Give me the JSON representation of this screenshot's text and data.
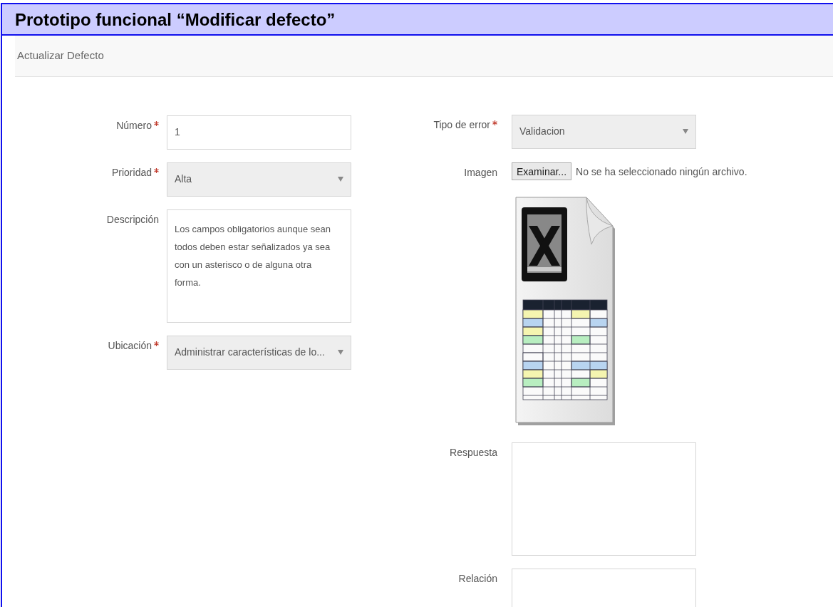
{
  "document_heading": "Prototipo funcional “Modificar defecto”",
  "panel": {
    "title": "Actualizar Defecto"
  },
  "left_fields": [
    {
      "kind": "text",
      "label": "Número",
      "required": true,
      "value": "1"
    },
    {
      "kind": "select",
      "label": "Prioridad",
      "required": true,
      "value": "Alta"
    },
    {
      "kind": "textarea",
      "label": "Descripción",
      "required": false,
      "value": "Los campos obligatorios aunque sean todos deben estar señalizados ya sea con un asterisco o de alguna otra forma."
    },
    {
      "kind": "select",
      "label": "Ubicación",
      "required": true,
      "value": "Administrar características de lo..."
    }
  ],
  "right_fields": [
    {
      "kind": "select",
      "label": "Tipo de error",
      "required": true,
      "value": "Validacion"
    },
    {
      "kind": "file",
      "label": "Imagen",
      "required": false,
      "button": "Examinar...",
      "status": "No se ha seleccionado ningún archivo.",
      "preview": true
    },
    {
      "kind": "textarea",
      "label": "Respuesta",
      "required": false
    },
    {
      "kind": "textarea",
      "label": "Relación",
      "required": false
    }
  ]
}
